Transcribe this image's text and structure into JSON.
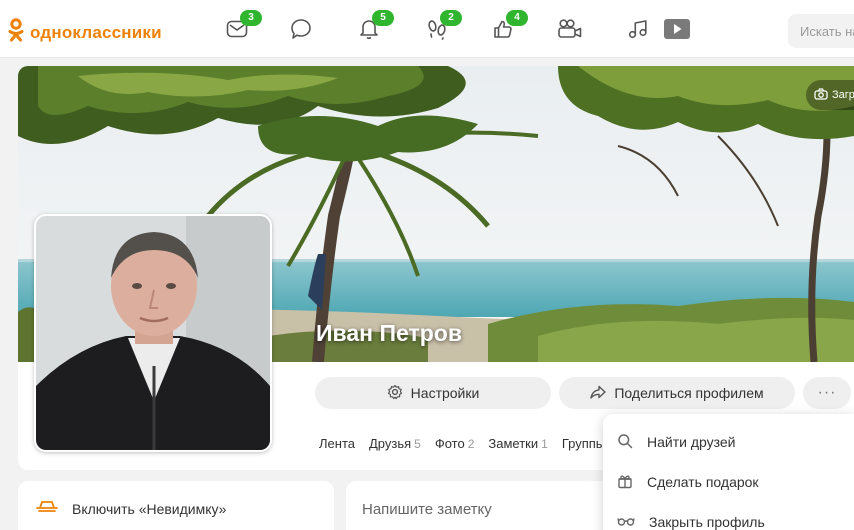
{
  "app": {
    "logo_text": "одноклассники",
    "accent": "#ee8208",
    "badge_color": "#2fb52e"
  },
  "nav": {
    "items": [
      {
        "name": "messages",
        "icon": "envelope-icon",
        "badge": "3"
      },
      {
        "name": "discussions",
        "icon": "chat-bubble-icon",
        "badge": ""
      },
      {
        "name": "notifications",
        "icon": "bell-icon",
        "badge": "5"
      },
      {
        "name": "guests",
        "icon": "footprints-icon",
        "badge": "2"
      },
      {
        "name": "events",
        "icon": "thumbs-up-icon",
        "badge": "4"
      },
      {
        "name": "video",
        "icon": "video-camera-icon",
        "badge": ""
      },
      {
        "name": "music",
        "icon": "music-note-icon",
        "badge": ""
      },
      {
        "name": "play",
        "icon": "play-icon",
        "badge": ""
      }
    ]
  },
  "search": {
    "placeholder": "Искать на сайте"
  },
  "profile": {
    "name": "Иван Петров",
    "cover_edit_label": "Загрузить обложку",
    "settings_button": "Настройки",
    "share_button": "Поделиться профилем",
    "more_button": "···",
    "tabs": [
      {
        "label": "Лента",
        "count": ""
      },
      {
        "label": "Друзья",
        "count": "5"
      },
      {
        "label": "Фото",
        "count": "2"
      },
      {
        "label": "Заметки",
        "count": "1"
      },
      {
        "label": "Группы",
        "count": ""
      }
    ]
  },
  "invisible": {
    "label": "Включить «Невидимку»"
  },
  "note": {
    "placeholder": "Напишите заметку"
  },
  "menu": {
    "items": [
      {
        "label": "Найти друзей",
        "icon": "search-icon"
      },
      {
        "label": "Сделать подарок",
        "icon": "gift-icon"
      },
      {
        "label": "Закрыть профиль",
        "icon": "glasses-icon"
      }
    ]
  }
}
